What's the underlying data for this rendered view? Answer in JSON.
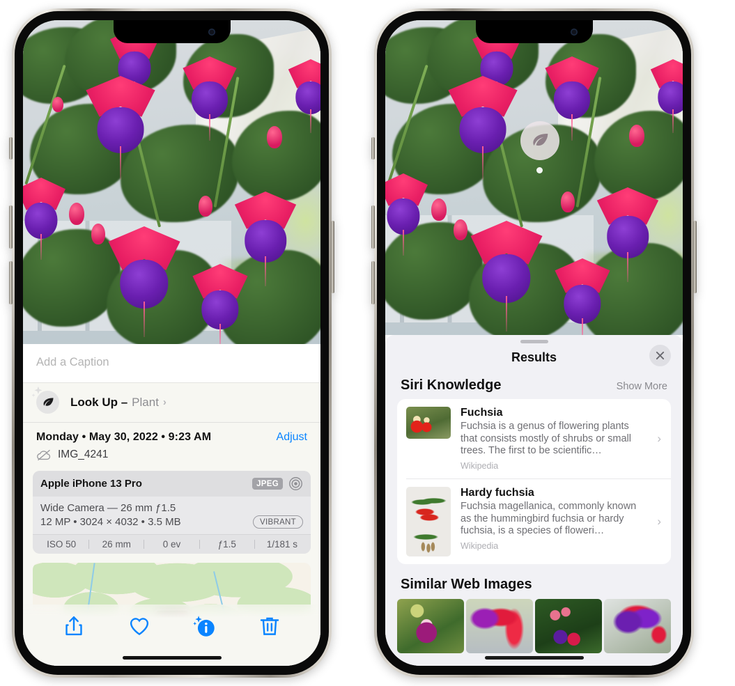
{
  "left_phone": {
    "caption_placeholder": "Add a Caption",
    "lookup": {
      "label": "Look Up –",
      "subject": "Plant",
      "chevron": "›",
      "icon": "leaf-icon"
    },
    "date": "Monday • May 30, 2022 • 9:23 AM",
    "adjust_label": "Adjust",
    "filename": "IMG_4241",
    "cloud_icon": "icloud-slash-icon",
    "metadata": {
      "device": "Apple iPhone 13 Pro",
      "format_badge": "JPEG",
      "aperture_icon": "aperture-icon",
      "lens_line": "Wide Camera — 26 mm ƒ1.5",
      "spec_line": "12 MP • 3024 × 4032 • 3.5 MB",
      "style_badge": "VIBRANT",
      "exif": [
        "ISO 50",
        "26 mm",
        "0 ev",
        "ƒ1.5",
        "1/181 s"
      ]
    },
    "toolbar": [
      {
        "name": "share-icon",
        "label": "Share"
      },
      {
        "name": "heart-icon",
        "label": "Favorite"
      },
      {
        "name": "info-sparkle-icon",
        "label": "Info"
      },
      {
        "name": "trash-icon",
        "label": "Delete"
      }
    ]
  },
  "right_phone": {
    "photo_pin_icon": "leaf-icon",
    "sheet_title": "Results",
    "close_icon": "close-icon",
    "siri_section": {
      "heading": "Siri Knowledge",
      "show_more": "Show More",
      "items": [
        {
          "title": "Fuchsia",
          "description": "Fuchsia is a genus of flowering plants that consists mostly of shrubs or small trees. The first to be scientific…",
          "source": "Wikipedia",
          "thumb": "fuchsia-red-thumb",
          "chevron": "›"
        },
        {
          "title": "Hardy fuchsia",
          "description": "Fuchsia magellanica, commonly known as the hummingbird fuchsia or hardy fuchsia, is a species of floweri…",
          "source": "Wikipedia",
          "thumb": "hardy-fuchsia-thumb",
          "chevron": "›"
        }
      ]
    },
    "similar_section": {
      "heading": "Similar Web Images",
      "images": [
        {
          "name": "similar-image-1"
        },
        {
          "name": "similar-image-2"
        },
        {
          "name": "similar-image-3"
        },
        {
          "name": "similar-image-4"
        }
      ]
    }
  },
  "colors": {
    "accent_blue": "#0a84ff",
    "sheet_bg": "#f7f7f2",
    "results_bg": "#f1f1f5",
    "muted_text": "#8a8a8f"
  }
}
